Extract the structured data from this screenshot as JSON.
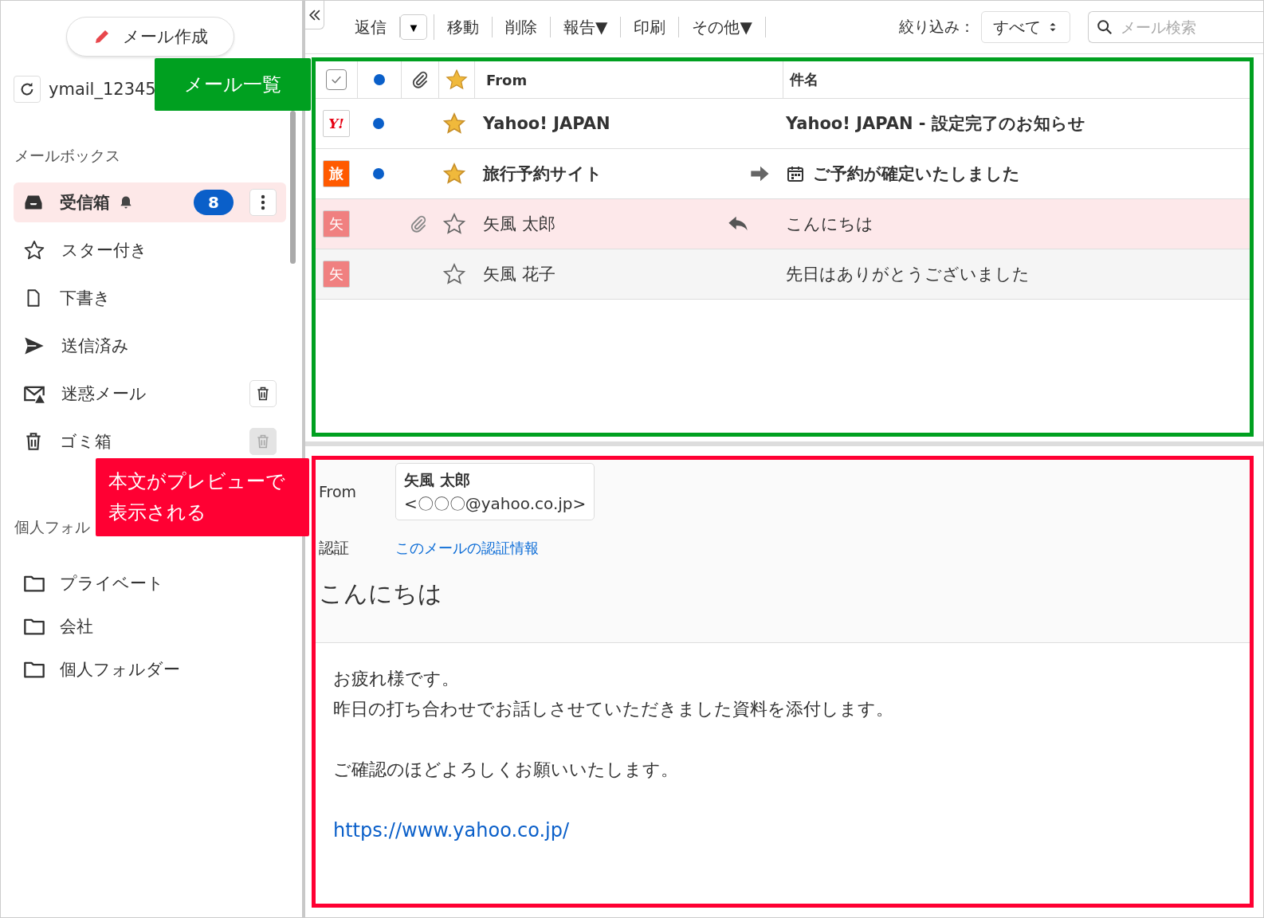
{
  "sidebar": {
    "compose_button": "メール作成",
    "account": "ymail_12345",
    "mailbox_heading": "メールボックス",
    "mailboxes": [
      {
        "label": "受信箱",
        "selected": true,
        "notify": true,
        "badge": "8",
        "menu": true
      },
      {
        "label": "スター付き",
        "selected": false
      },
      {
        "label": "下書き",
        "selected": false
      },
      {
        "label": "送信済み",
        "selected": false
      },
      {
        "label": "迷惑メール",
        "selected": false,
        "empty_button": {
          "disabled": false
        }
      },
      {
        "label": "ゴミ箱",
        "selected": false,
        "empty_button": {
          "disabled": true
        }
      }
    ],
    "folder_heading": "個人フォル",
    "folders": [
      {
        "label": "プライベート"
      },
      {
        "label": "会社"
      },
      {
        "label": "個人フォルダー"
      }
    ]
  },
  "toolbar": {
    "actions": [
      {
        "label": "返信",
        "kind": "button"
      },
      {
        "label": "▼",
        "kind": "dropdown"
      },
      {
        "label": "移動",
        "kind": "button"
      },
      {
        "label": "削除",
        "kind": "button"
      },
      {
        "label": "報告▼",
        "kind": "button"
      },
      {
        "label": "印刷",
        "kind": "button"
      },
      {
        "label": "その他▼",
        "kind": "button"
      }
    ],
    "filter_label": "絞り込み：",
    "filter_value": "すべて",
    "search": {
      "placeholder": "メール検索"
    }
  },
  "list": {
    "header_checkbox": {
      "checked": true
    },
    "columns": [
      "From",
      "件名"
    ],
    "rows": [
      {
        "avatar": {
          "text": "Y!",
          "kind": "logo",
          "color": "#e60012"
        },
        "unread": true,
        "attachment": false,
        "starred": true,
        "selected": false,
        "from": "Yahoo! JAPAN",
        "forwarded": false,
        "replied": false,
        "calendar": false,
        "subject": "Yahoo! JAPAN - 設定完了のお知らせ"
      },
      {
        "avatar": {
          "text": "旅",
          "kind": "letter",
          "color": "#ff5a00"
        },
        "unread": true,
        "attachment": false,
        "starred": true,
        "selected": false,
        "from": "旅行予約サイト",
        "forwarded": true,
        "replied": false,
        "calendar": true,
        "subject": "ご予約が確定いたしました"
      },
      {
        "avatar": {
          "text": "矢",
          "kind": "letter",
          "color": "#f08080"
        },
        "unread": false,
        "attachment": true,
        "starred": false,
        "selected": true,
        "from": "矢風 太郎",
        "forwarded": false,
        "replied": true,
        "calendar": false,
        "subject": "こんにちは"
      },
      {
        "avatar": {
          "text": "矢",
          "kind": "letter",
          "color": "#f08080"
        },
        "unread": false,
        "attachment": false,
        "starred": false,
        "selected": false,
        "from": "矢風 花子",
        "forwarded": false,
        "replied": false,
        "calendar": false,
        "subject": "先日はありがとうございました"
      }
    ]
  },
  "preview": {
    "from_label": "From",
    "sender_name": "矢風 太郎",
    "sender_address": "<〇〇〇@yahoo.co.jp>",
    "auth_label": "認証",
    "auth_link": "このメールの認証情報",
    "subject": "こんにちは",
    "body": [
      [
        "お疲れ様です。",
        "昨日の打ち合わせでお話しさせていただきました資料を添付します。"
      ],
      [
        "ご確認のほどよろしくお願いいたします。"
      ]
    ],
    "link": "https://www.yahoo.co.jp/"
  },
  "annotations": [
    {
      "text": "メール一覧",
      "color": "#00a020"
    },
    {
      "text": "本文がプレビューで表示される",
      "color": "#ff0033"
    }
  ]
}
